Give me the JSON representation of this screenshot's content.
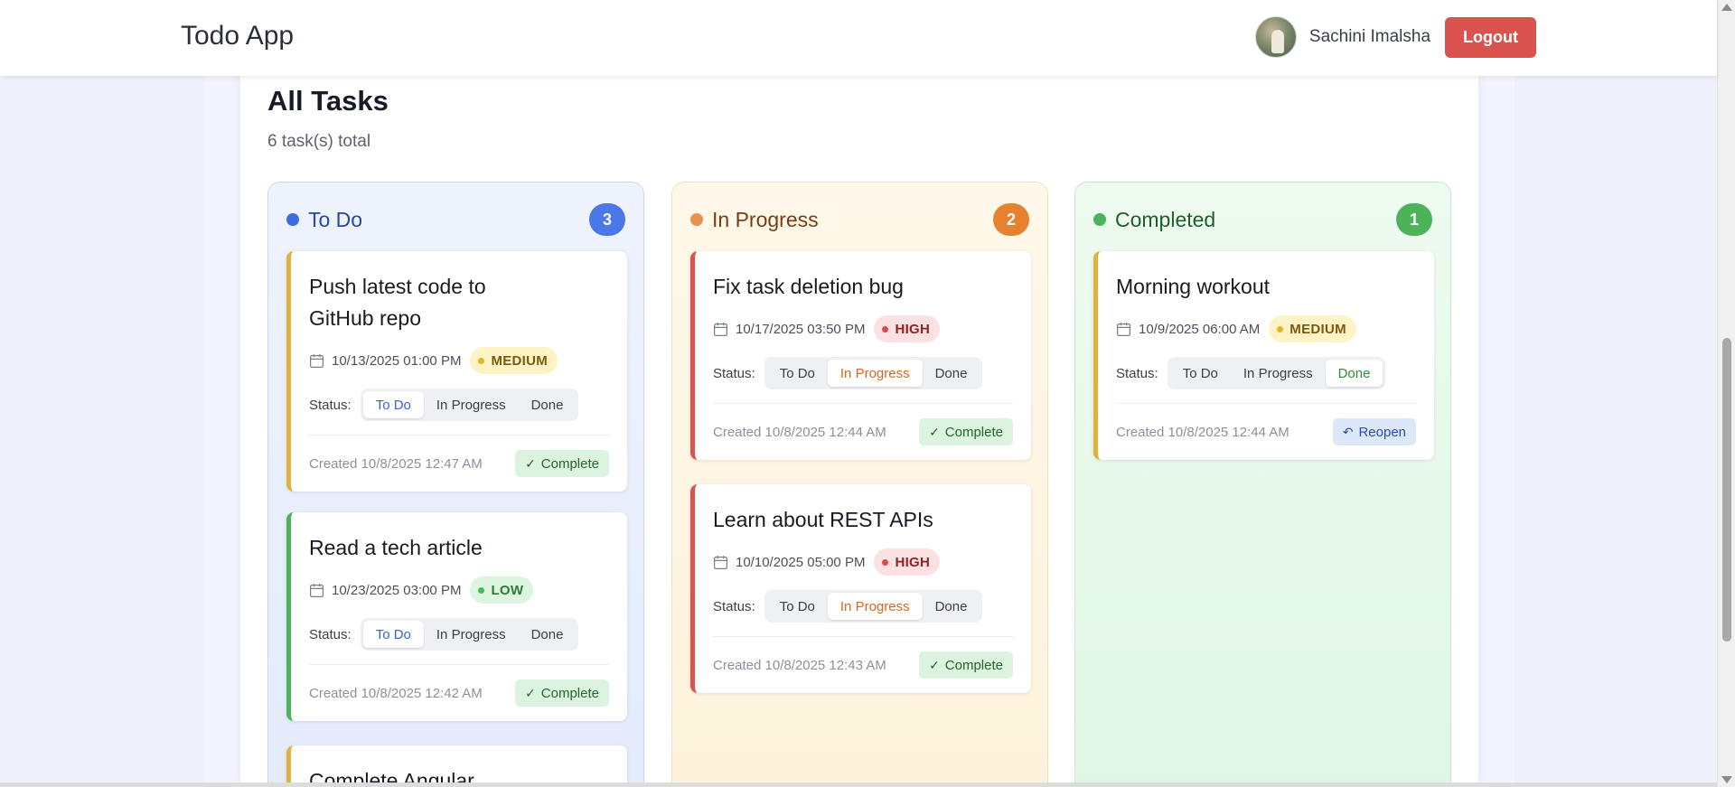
{
  "header": {
    "app_title": "Todo App",
    "user_name": "Sachini Imalsha",
    "logout_label": "Logout"
  },
  "page": {
    "title": "All Tasks",
    "total": "6 task(s) total"
  },
  "status_label": "Status:",
  "status_options": [
    "To Do",
    "In Progress",
    "Done"
  ],
  "columns": [
    {
      "name": "To Do",
      "count": "3",
      "color": "#3b6fe0",
      "tasks": [
        {
          "title_lines": [
            "Push latest code to",
            "GitHub repo"
          ],
          "date": "10/13/2025 01:00 PM",
          "priority": "MEDIUM",
          "status": "To Do",
          "created": "Created 10/8/2025 12:47 AM",
          "action": "Complete"
        },
        {
          "title_lines": [
            "Read a tech article"
          ],
          "date": "10/23/2025 03:00 PM",
          "priority": "LOW",
          "status": "To Do",
          "created": "Created 10/8/2025 12:42 AM",
          "action": "Complete"
        },
        {
          "title_lines": [
            "Complete Angular"
          ]
        }
      ]
    },
    {
      "name": "In Progress",
      "count": "2",
      "color": "#e6822f",
      "tasks": [
        {
          "title_lines": [
            "Fix task deletion bug"
          ],
          "date": "10/17/2025 03:50 PM",
          "priority": "HIGH",
          "status": "In Progress",
          "created": "Created 10/8/2025 12:44 AM",
          "action": "Complete"
        },
        {
          "title_lines": [
            "Learn about REST APIs"
          ],
          "date": "10/10/2025 05:00 PM",
          "priority": "HIGH",
          "status": "In Progress",
          "created": "Created 10/8/2025 12:43 AM",
          "action": "Complete"
        }
      ]
    },
    {
      "name": "Completed",
      "count": "1",
      "color": "#4db35a",
      "tasks": [
        {
          "title_lines": [
            "Morning workout"
          ],
          "date": "10/9/2025 06:00 AM",
          "priority": "MEDIUM",
          "status": "Done",
          "created": "Created 10/8/2025 12:44 AM",
          "action": "Reopen"
        }
      ]
    }
  ],
  "colors": {
    "high": "#d9534f",
    "medium": "#e0b23c",
    "low": "#4db35a",
    "logout": "#d9534f"
  },
  "icons": {
    "date": "calendar-icon",
    "complete": "check-icon",
    "reopen": "undo-icon"
  }
}
